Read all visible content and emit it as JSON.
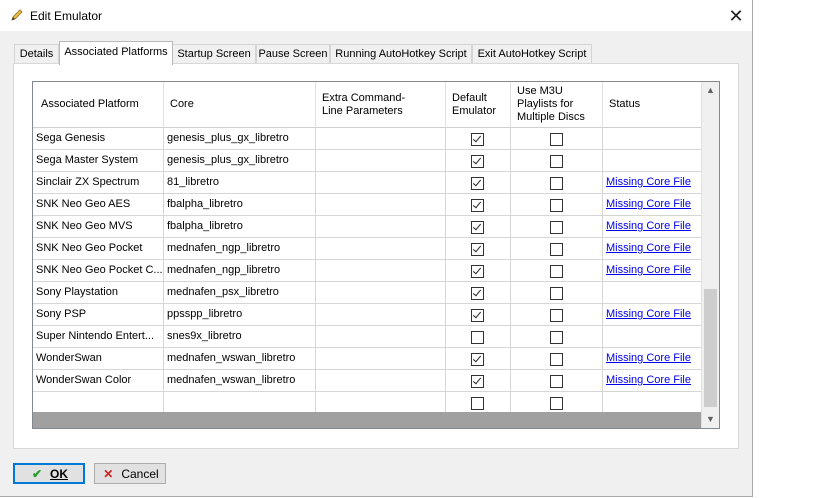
{
  "window": {
    "title": "Edit Emulator",
    "title_icon": "pencil-icon",
    "close_glyph": "✕"
  },
  "tabs": [
    {
      "label": "Details",
      "active": false
    },
    {
      "label": "Associated Platforms",
      "active": true
    },
    {
      "label": "Startup Screen",
      "active": false
    },
    {
      "label": "Pause Screen",
      "active": false
    },
    {
      "label": "Running AutoHotkey Script",
      "active": false
    },
    {
      "label": "Exit AutoHotkey Script",
      "active": false
    }
  ],
  "grid": {
    "columns": [
      {
        "label": "Associated Platform"
      },
      {
        "label": "Core"
      },
      {
        "label": "Extra Command-Line Parameters"
      },
      {
        "label": "Default Emulator"
      },
      {
        "label": "Use M3U Playlists for Multiple Discs"
      },
      {
        "label": "Status"
      }
    ],
    "rows": [
      {
        "platform": "Sega Genesis",
        "core": "genesis_plus_gx_libretro",
        "params": "",
        "default": true,
        "m3u": false,
        "status": ""
      },
      {
        "platform": "Sega Master System",
        "core": "genesis_plus_gx_libretro",
        "params": "",
        "default": true,
        "m3u": false,
        "status": ""
      },
      {
        "platform": "Sinclair ZX Spectrum",
        "core": "81_libretro",
        "params": "",
        "default": true,
        "m3u": false,
        "status": "Missing Core File"
      },
      {
        "platform": "SNK Neo Geo AES",
        "core": "fbalpha_libretro",
        "params": "",
        "default": true,
        "m3u": false,
        "status": "Missing Core File"
      },
      {
        "platform": "SNK Neo Geo MVS",
        "core": "fbalpha_libretro",
        "params": "",
        "default": true,
        "m3u": false,
        "status": "Missing Core File"
      },
      {
        "platform": "SNK Neo Geo Pocket",
        "core": "mednafen_ngp_libretro",
        "params": "",
        "default": true,
        "m3u": false,
        "status": "Missing Core File"
      },
      {
        "platform": "SNK Neo Geo Pocket C...",
        "core": "mednafen_ngp_libretro",
        "params": "",
        "default": true,
        "m3u": false,
        "status": "Missing Core File"
      },
      {
        "platform": "Sony Playstation",
        "core": "mednafen_psx_libretro",
        "params": "",
        "default": true,
        "m3u": false,
        "status": ""
      },
      {
        "platform": "Sony PSP",
        "core": "ppsspp_libretro",
        "params": "",
        "default": true,
        "m3u": false,
        "status": "Missing Core File"
      },
      {
        "platform": "Super Nintendo Entert...",
        "core": "snes9x_libretro",
        "params": "",
        "default": false,
        "m3u": false,
        "status": ""
      },
      {
        "platform": "WonderSwan",
        "core": "mednafen_wswan_libretro",
        "params": "",
        "default": true,
        "m3u": false,
        "status": "Missing Core File"
      },
      {
        "platform": "WonderSwan Color",
        "core": "mednafen_wswan_libretro",
        "params": "",
        "default": true,
        "m3u": false,
        "status": "Missing Core File"
      },
      {
        "platform": "",
        "core": "",
        "params": "",
        "default": false,
        "m3u": false,
        "status": ""
      }
    ]
  },
  "buttons": {
    "ok": {
      "label": "OK",
      "icon": "checkmark-icon"
    },
    "cancel": {
      "label": "Cancel",
      "icon": "x-icon"
    }
  },
  "colors": {
    "link": "#0000ee",
    "focus": "#0078d7",
    "ok_icon": "#2aa12a",
    "cancel_icon": "#d02020"
  }
}
